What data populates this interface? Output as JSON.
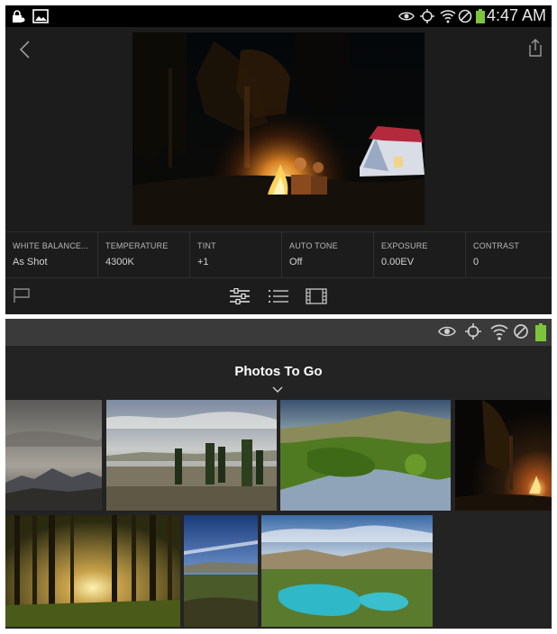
{
  "top_screen": {
    "status_bar": {
      "time": "4:47 AM",
      "icons": [
        "lock-icon",
        "gallery-icon",
        "eye-icon",
        "gps-icon",
        "wifi-icon",
        "blocked-icon",
        "battery-icon"
      ],
      "battery_color": "#7cc53a"
    },
    "nav": {
      "back_icon": "chevron-left-icon",
      "share_icon": "share-icon"
    },
    "adjustments": [
      {
        "label": "WHITE BALANCE...",
        "value": "As Shot"
      },
      {
        "label": "TEMPERATURE",
        "value": "4300K"
      },
      {
        "label": "TINT",
        "value": "+1"
      },
      {
        "label": "AUTO TONE",
        "value": "Off"
      },
      {
        "label": "EXPOSURE",
        "value": "0.00EV"
      },
      {
        "label": "CONTRAST",
        "value": "0"
      }
    ],
    "toolbar": {
      "icons": [
        "flag-icon",
        "sliders-icon",
        "list-icon",
        "filmstrip-icon"
      ]
    }
  },
  "bottom_screen": {
    "status_bar": {
      "icons": [
        "eye-icon",
        "gps-icon",
        "wifi-icon",
        "blocked-icon",
        "battery-icon"
      ],
      "battery_color": "#7cc53a"
    },
    "album_title": "Photos To Go",
    "album_icon": "chevron-down-icon",
    "thumbnails": [
      "mountain-dusk",
      "green-field-trees",
      "river-valley",
      "campfire-night",
      "forest-sunset",
      "blue-sky-plain",
      "turquoise-lagoon"
    ]
  }
}
